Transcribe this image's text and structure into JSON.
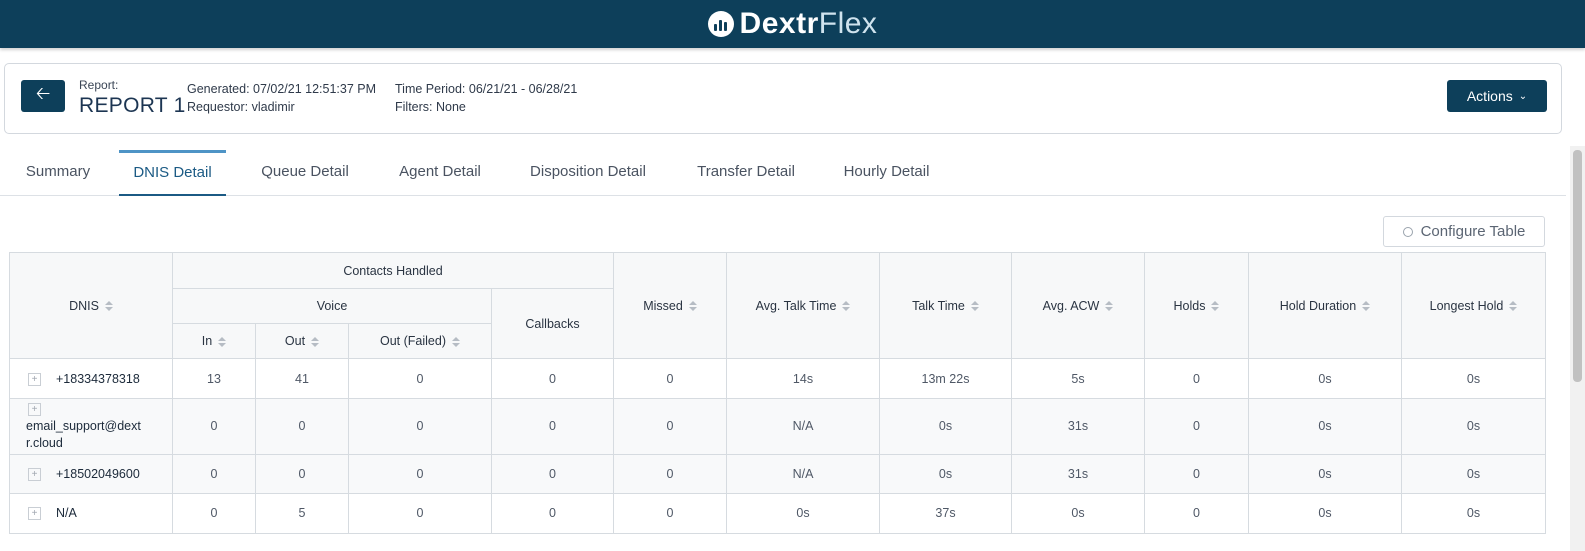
{
  "app": {
    "logo_primary": "Dextr",
    "logo_secondary": "Flex",
    "brand_color": "#0d3f5a"
  },
  "report": {
    "label": "Report:",
    "name": "REPORT 1",
    "generated": "Generated: 07/02/21 12:51:37 PM",
    "requestor": "Requestor: vladimir",
    "time_period": "Time Period: 06/21/21 - 06/28/21",
    "filters": "Filters: None",
    "back_icon": "arrow-left-icon",
    "actions_label": "Actions"
  },
  "tabs": [
    {
      "label": "Summary"
    },
    {
      "label": "DNIS Detail",
      "active": true
    },
    {
      "label": "Queue Detail"
    },
    {
      "label": "Agent Detail"
    },
    {
      "label": "Disposition Detail"
    },
    {
      "label": "Transfer Detail"
    },
    {
      "label": "Hourly Detail"
    }
  ],
  "configure_label": "Configure Table",
  "table": {
    "headers": {
      "dnis": "DNIS",
      "contacts_handled": "Contacts Handled",
      "voice": "Voice",
      "in": "In",
      "out": "Out",
      "out_failed": "Out (Failed)",
      "callbacks": "Callbacks",
      "missed": "Missed",
      "avg_talk_time": "Avg. Talk Time",
      "talk_time": "Talk Time",
      "avg_acw": "Avg. ACW",
      "holds": "Holds",
      "hold_duration": "Hold Duration",
      "longest_hold": "Longest Hold"
    },
    "rows": [
      {
        "dnis": "+18334378318",
        "in": "13",
        "out": "41",
        "out_failed": "0",
        "callbacks": "0",
        "missed": "0",
        "avg_talk_time": "14s",
        "talk_time": "13m 22s",
        "avg_acw": "5s",
        "holds": "0",
        "hold_duration": "0s",
        "longest_hold": "0s"
      },
      {
        "dnis_line1": "email_support@dext",
        "dnis_line2": "r.cloud",
        "in": "0",
        "out": "0",
        "out_failed": "0",
        "callbacks": "0",
        "missed": "0",
        "avg_talk_time": "N/A",
        "talk_time": "0s",
        "avg_acw": "31s",
        "holds": "0",
        "hold_duration": "0s",
        "longest_hold": "0s"
      },
      {
        "dnis": "+18502049600",
        "in": "0",
        "out": "0",
        "out_failed": "0",
        "callbacks": "0",
        "missed": "0",
        "avg_talk_time": "N/A",
        "talk_time": "0s",
        "avg_acw": "31s",
        "holds": "0",
        "hold_duration": "0s",
        "longest_hold": "0s"
      },
      {
        "dnis": "N/A",
        "in": "0",
        "out": "5",
        "out_failed": "0",
        "callbacks": "0",
        "missed": "0",
        "avg_talk_time": "0s",
        "talk_time": "37s",
        "avg_acw": "0s",
        "holds": "0",
        "hold_duration": "0s",
        "longest_hold": "0s"
      }
    ]
  }
}
